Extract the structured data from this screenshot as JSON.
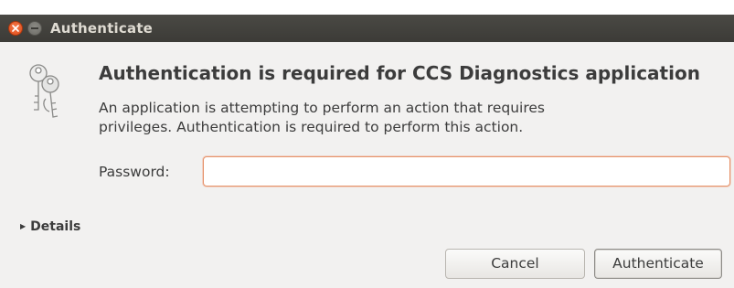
{
  "window": {
    "title": "Authenticate"
  },
  "dialog": {
    "icon": "keys-icon",
    "heading": "Authentication is required for CCS Diagnostics application",
    "description_line1": "An application is attempting to perform an action that requires",
    "description_line2": "privileges. Authentication is required to perform this action.",
    "password_label": "Password:",
    "password_value": "",
    "details_label": "Details",
    "cancel_label": "Cancel",
    "authenticate_label": "Authenticate"
  },
  "colors": {
    "titlebar": "#3c3b37",
    "close_button": "#df4a16",
    "input_focus_border": "#e6936b",
    "window_background": "#f2f1f0"
  }
}
